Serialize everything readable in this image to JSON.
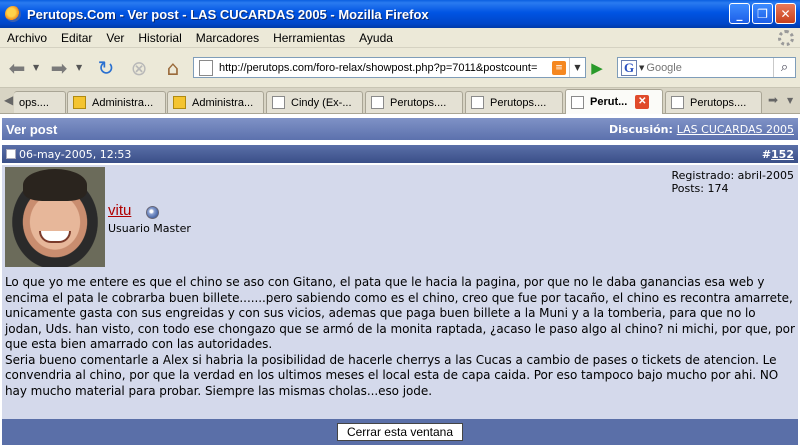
{
  "window": {
    "title": "Perutops.Com - Ver post - LAS CUCARDAS 2005 - Mozilla Firefox",
    "controls": [
      "_",
      "❐",
      "✕"
    ]
  },
  "menu": [
    "Archivo",
    "Editar",
    "Ver",
    "Historial",
    "Marcadores",
    "Herramientas",
    "Ayuda"
  ],
  "nav": {
    "url": "http://perutops.com/foro-relax/showpost.php?p=7011&postcount=",
    "search_placeholder": "Google",
    "icons": [
      "back-icon",
      "forward-icon",
      "reload-icon",
      "stop-icon",
      "home-icon",
      "rss-icon",
      "go-icon",
      "google-icon",
      "search-icon"
    ]
  },
  "tabs": [
    {
      "label": "ops....",
      "type": "page"
    },
    {
      "label": "Administra...",
      "type": "admin"
    },
    {
      "label": "Administra...",
      "type": "admin"
    },
    {
      "label": "Cindy (Ex-...",
      "type": "page"
    },
    {
      "label": "Perutops....",
      "type": "page"
    },
    {
      "label": "Perutops....",
      "type": "page"
    },
    {
      "label": "Perut...",
      "type": "page",
      "active": true
    },
    {
      "label": "Perutops....",
      "type": "page"
    }
  ],
  "page": {
    "heading": "Ver post",
    "discussion_label": "Discusión:",
    "discussion_link": "LAS CUCARDAS 2005",
    "post": {
      "date": "06-may-2005, 12:53",
      "number_prefix": "#",
      "number": "152",
      "username": "vitu",
      "user_title": "Usuario Master",
      "registered": "Registrado: abril-2005",
      "posts": "Posts: 174",
      "body_p1": "Lo que yo me entere es que el chino se aso con Gitano, el pata que le hacia la pagina, por que no le daba ganancias esa web y encima el pata le cobrarba buen billete.......pero sabiendo como es el chino, creo que fue por tacaño, el chino es recontra amarrete, unicamente gasta con sus engreidas y con sus vicios, ademas que paga buen billete a la Muni y a la tomberia, para que no lo jodan, Uds. han visto, con todo ese chongazo que se armó de la monita raptada, ¿acaso le paso algo al chino? ni michi, por que, por que esta bien amarrado con las autoridades.",
      "body_p2": "Seria bueno comentarle a Alex si habria la posibilidad de hacerle cherrys a las Cucas a cambio de pases o tickets de atencion. Le convendria al chino, por que la verdad en los ultimos meses el local esta de capa caida. Por eso tampoco bajo mucho por ahi. NO hay mucho material para probar. Siempre las mismas cholas...eso jode."
    },
    "close_button": "Cerrar esta ventana"
  }
}
